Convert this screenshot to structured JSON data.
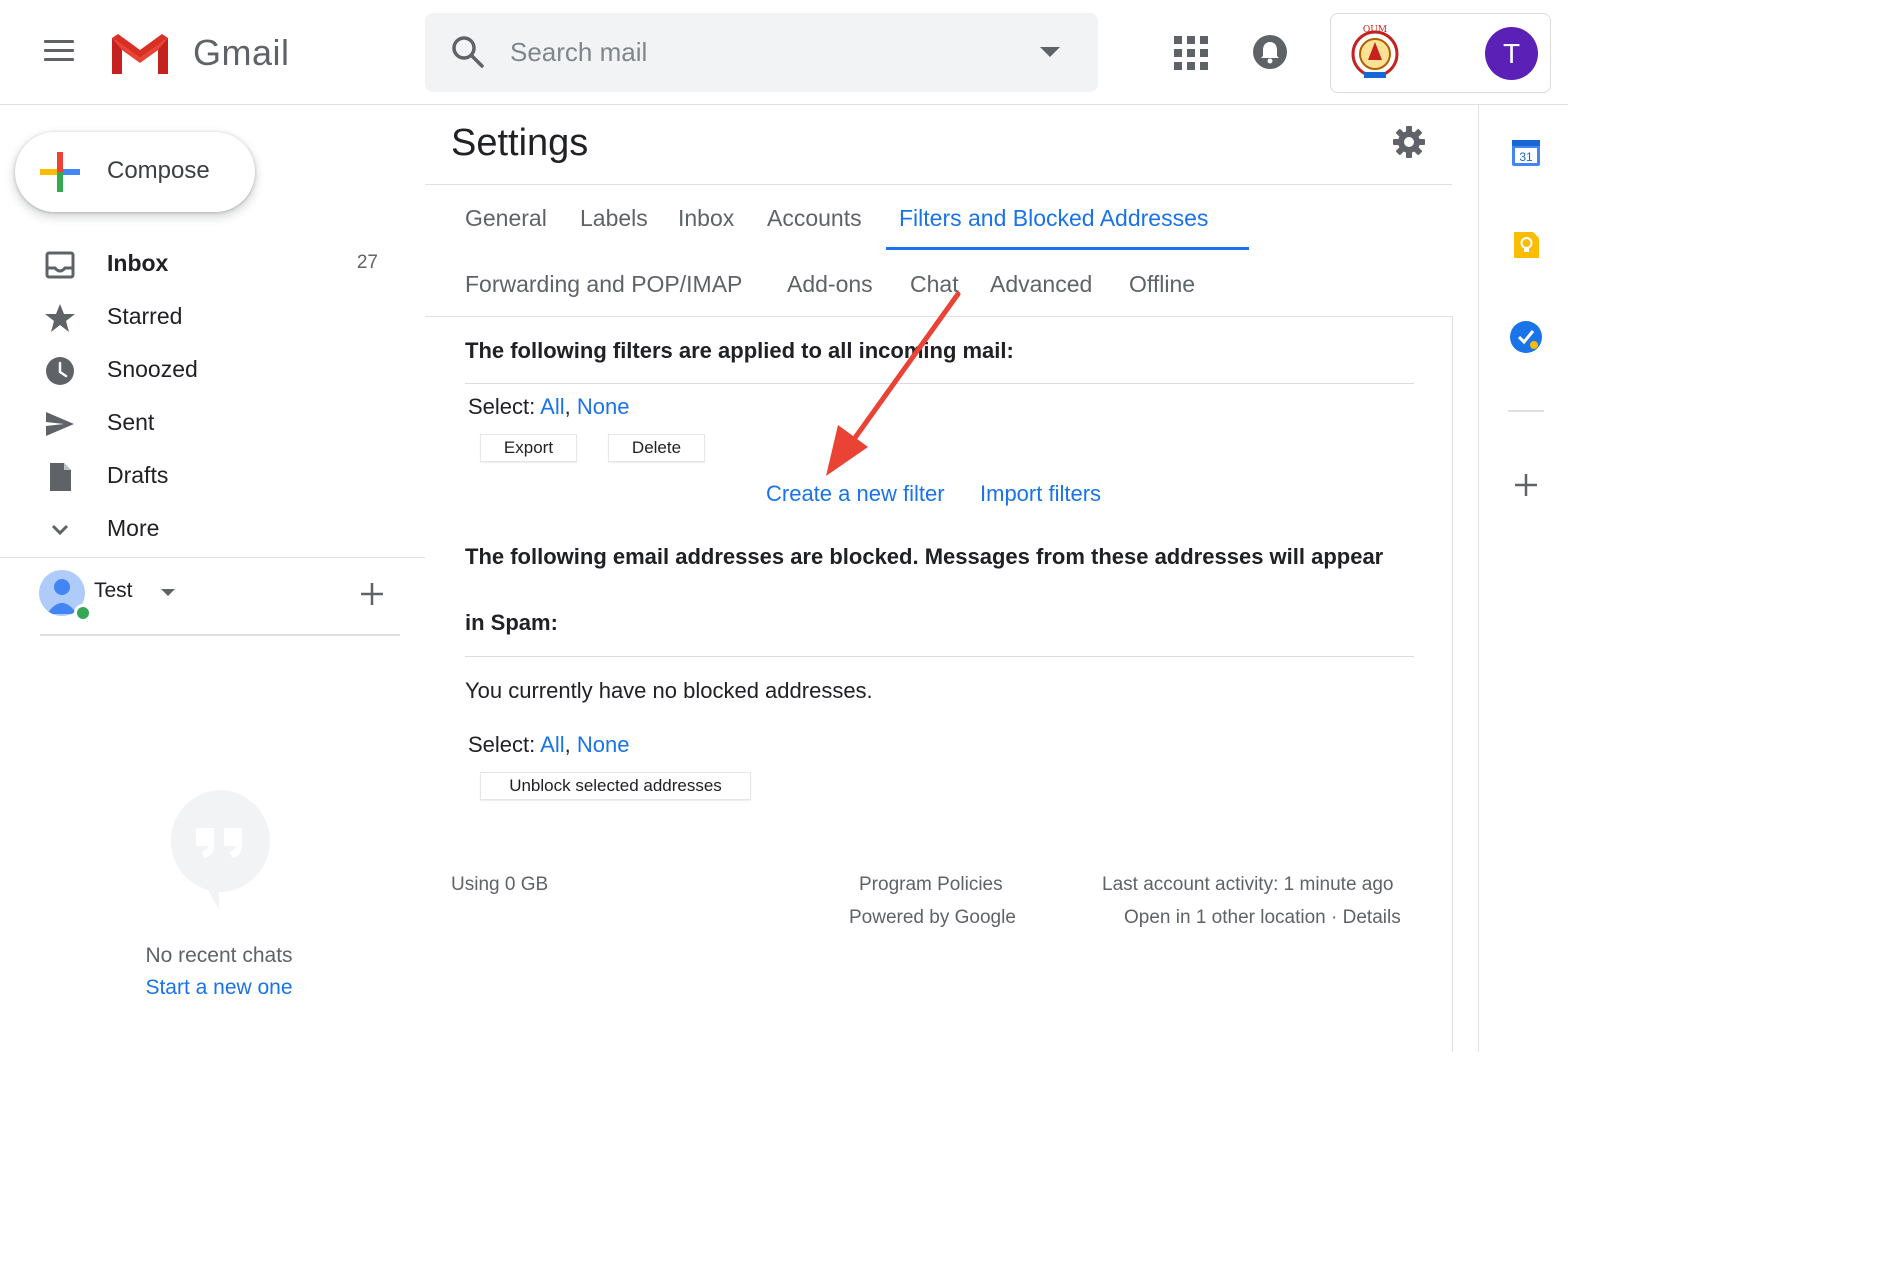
{
  "header": {
    "app_name": "Gmail",
    "search_placeholder": "Search mail",
    "account_initial": "T",
    "colors": {
      "avatar": "#5b21b6",
      "accent": "#1a73e8"
    }
  },
  "sidebar": {
    "compose_label": "Compose",
    "items": [
      {
        "label": "Inbox",
        "count": "27",
        "icon": "inbox-icon"
      },
      {
        "label": "Starred",
        "count": "",
        "icon": "star-icon"
      },
      {
        "label": "Snoozed",
        "count": "",
        "icon": "clock-icon"
      },
      {
        "label": "Sent",
        "count": "",
        "icon": "send-icon"
      },
      {
        "label": "Drafts",
        "count": "",
        "icon": "draft-icon"
      },
      {
        "label": "More",
        "count": "",
        "icon": "chevron-down-icon"
      }
    ],
    "hangouts": {
      "user_name": "Test",
      "no_chats": "No recent chats",
      "start_new": "Start a new one"
    }
  },
  "settings": {
    "title": "Settings",
    "tabs_row1": [
      "General",
      "Labels",
      "Inbox",
      "Accounts",
      "Filters and Blocked Addresses"
    ],
    "tabs_row2": [
      "Forwarding and POP/IMAP",
      "Add-ons",
      "Chat",
      "Advanced",
      "Offline"
    ],
    "active_tab": "Filters and Blocked Addresses",
    "filters": {
      "heading": "The following filters are applied to all incoming mail:",
      "select_label": "Select:",
      "select_all": "All",
      "select_none": "None",
      "export_button": "Export",
      "delete_button": "Delete",
      "create_filter": "Create a new filter",
      "import_filters": "Import filters"
    },
    "blocked": {
      "heading_line1": "The following email addresses are blocked. Messages from these addresses will appear",
      "heading_line2": "in Spam:",
      "empty_text": "You currently have no blocked addresses.",
      "select_label": "Select:",
      "select_all": "All",
      "select_none": "None",
      "unblock_button": "Unblock selected addresses"
    },
    "footer": {
      "storage": "Using 0 GB",
      "program_policies": "Program Policies",
      "powered_by": "Powered by Google",
      "last_activity": "Last account activity: 1 minute ago",
      "open_locations": "Open in 1 other location",
      "separator": "·",
      "details": "Details"
    }
  },
  "right_rail": {
    "calendar_day": "31"
  },
  "annotation": {
    "arrow_color": "#ea4335"
  }
}
